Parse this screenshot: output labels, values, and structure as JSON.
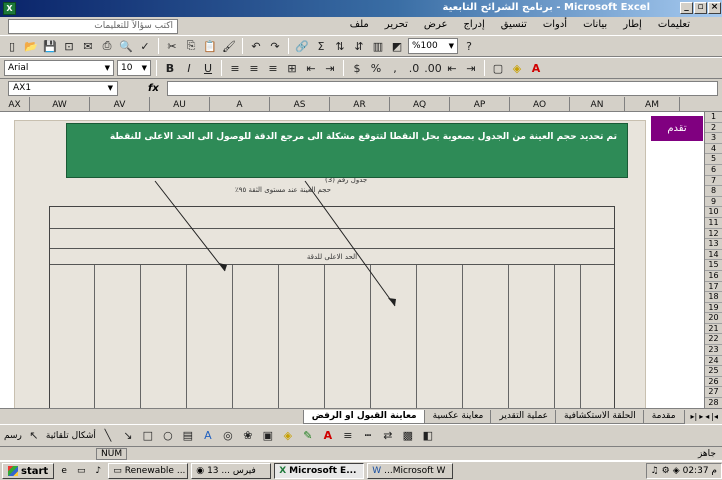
{
  "window": {
    "title": "Microsoft Excel - برنامج الشرائح التابعية",
    "app_icon": "X",
    "controls": [
      "_",
      "▫",
      "×"
    ]
  },
  "menu": {
    "help_placeholder": "اكتب سؤالاً للتعليمات",
    "items": [
      "ملف",
      "تحرير",
      "عرض",
      "إدراج",
      "تنسيق",
      "أدوات",
      "بيانات",
      "إطار",
      "تعليمات"
    ]
  },
  "toolbar": {
    "font_name": "Arial",
    "font_size": "10",
    "zoom": "%100"
  },
  "formula_bar": {
    "name_box": "AX1",
    "fx_label": "fx",
    "value": ""
  },
  "columns": [
    "AM",
    "AN",
    "AO",
    "AP",
    "AQ",
    "AR",
    "AS",
    "A",
    "AU",
    "AV",
    "AW",
    "AX"
  ],
  "rows": [
    "1",
    "2",
    "3",
    "4",
    "5",
    "6",
    "7",
    "8",
    "9",
    "10",
    "11",
    "12",
    "13",
    "14",
    "15",
    "16",
    "17",
    "18",
    "19",
    "20",
    "21",
    "22",
    "23",
    "24",
    "25",
    "26",
    "27",
    "28"
  ],
  "annotation": {
    "text": "تم تحديد حجم العينة من الجدول بصعوبة بحل النقطا لتتوقع مشكلة الى مرجع الدقة للوصول الى الحد الاعلى للنقطة",
    "purple_cell": "تقدم"
  },
  "scanned_table": {
    "caption1": "جدول رقم (3)",
    "caption2": "حجم العينة عند مستوى الثقة ٩٥٪",
    "subheader": "الحد الاعلى للدقة"
  },
  "sheet_tabs": [
    {
      "label": "مقدمة",
      "active": false
    },
    {
      "label": "الحلقة الاستكشافية",
      "active": false
    },
    {
      "label": "عملية التقدير",
      "active": false
    },
    {
      "label": "معاينة عكسية",
      "active": false
    },
    {
      "label": "معاينة القبول او الرفض",
      "active": true
    }
  ],
  "drawbar": {
    "draw_label": "رسم",
    "autoshapes_label": "أشكال تلقائية"
  },
  "status": {
    "ready": "جاهز",
    "num": "NUM"
  },
  "taskbar": {
    "start": "start",
    "items": [
      {
        "label": "Renewable ...",
        "active": false
      },
      {
        "label": "13 ... فيرس",
        "active": false
      },
      {
        "label": "Microsoft E...",
        "active": true
      },
      {
        "label": "...Microsoft W",
        "active": false
      }
    ],
    "clock": "02:37 م"
  }
}
